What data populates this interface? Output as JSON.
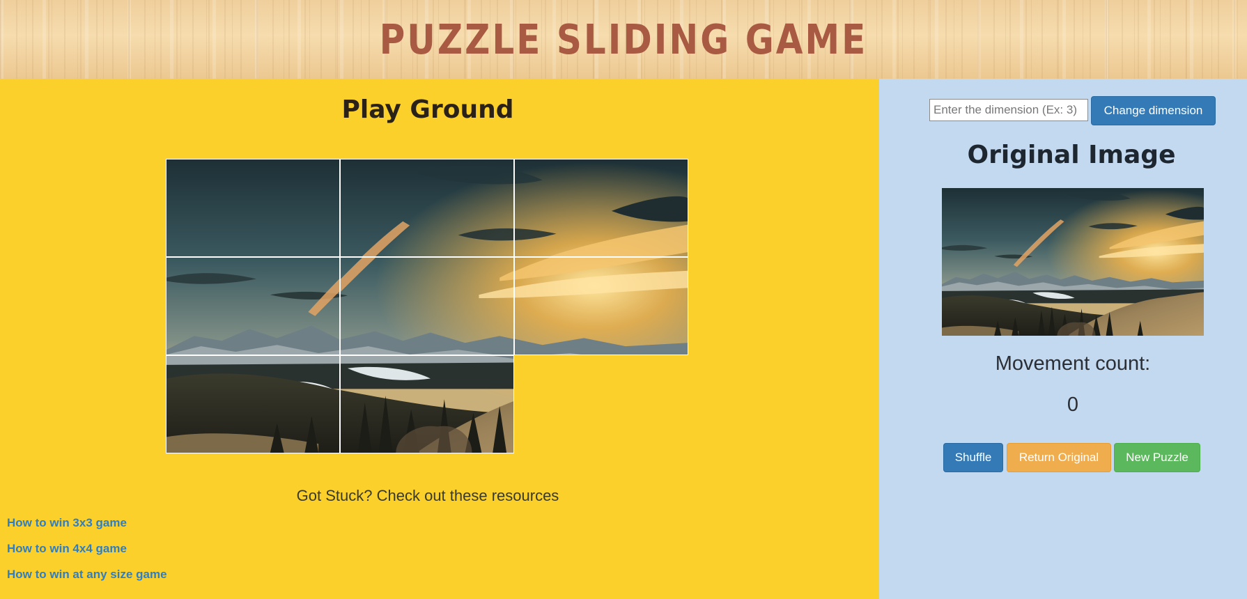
{
  "header": {
    "title": "Puzzle Sliding Game"
  },
  "play_ground": {
    "title": "Play Ground",
    "grid_dimension": 3,
    "tiles": [
      1,
      2,
      3,
      4,
      5,
      6,
      7,
      8,
      0
    ],
    "stuck_text": "Got Stuck? Check out these resources",
    "links": [
      {
        "label": "How to win 3x3 game"
      },
      {
        "label": "How to win 4x4 game"
      },
      {
        "label": "How to win at any size game"
      }
    ]
  },
  "panel": {
    "dimension_placeholder": "Enter the dimension (Ex: 3)",
    "change_dimension_label": "Change dimension",
    "original_image_title": "Original Image",
    "movement_label": "Movement count:",
    "movement_count": "0",
    "shuffle_label": "Shuffle",
    "return_original_label": "Return Original",
    "new_puzzle_label": "New Puzzle"
  },
  "colors": {
    "title_color": "#a85a43",
    "play_background": "#fbd02b",
    "panel_background": "#c2d9f0",
    "link_color": "#2f7ec3",
    "shuffle_button": "#337ab7",
    "return_button": "#f0ad4e",
    "new_puzzle_button": "#5cb85c"
  }
}
